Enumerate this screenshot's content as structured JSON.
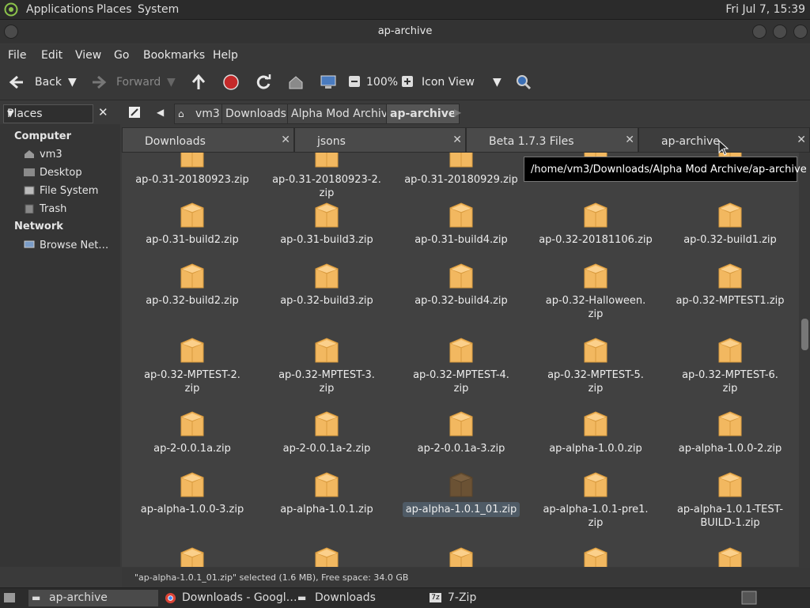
{
  "top_panel": {
    "menus": [
      "Applications",
      "Places",
      "System"
    ],
    "clock": "Fri Jul  7, 15:39"
  },
  "window": {
    "title": "ap-archive"
  },
  "menubar": [
    "File",
    "Edit",
    "View",
    "Go",
    "Bookmarks",
    "Help"
  ],
  "toolbar": {
    "back": "Back",
    "forward": "Forward",
    "zoom": "100%",
    "view_mode": "Icon View"
  },
  "sidebar": {
    "selector": "Places",
    "sections": [
      {
        "title": "Computer",
        "items": [
          "vm3",
          "Desktop",
          "File System",
          "Trash"
        ]
      },
      {
        "title": "Network",
        "items": [
          "Browse Net…"
        ]
      }
    ]
  },
  "breadcrumbs": [
    "vm3",
    "Downloads",
    "Alpha Mod Archive",
    "ap-archive"
  ],
  "tabs": [
    "Downloads",
    "jsons",
    "Beta 1.7.3 Files",
    "ap-archive"
  ],
  "tooltip": "/home/vm3/Downloads/Alpha Mod Archive/ap-archive",
  "files": [
    "ap-0.31-20180923.zip",
    "ap-0.31-20180923-2.zip",
    "ap-0.31-20180929.zip",
    "",
    "",
    "ap-0.31-build2.zip",
    "ap-0.31-build3.zip",
    "ap-0.31-build4.zip",
    "ap-0.32-20181106.zip",
    "ap-0.32-build1.zip",
    "ap-0.32-build2.zip",
    "ap-0.32-build3.zip",
    "ap-0.32-build4.zip",
    "ap-0.32-Halloween.zip",
    "ap-0.32-MPTEST1.zip",
    "ap-0.32-MPTEST-2.zip",
    "ap-0.32-MPTEST-3.zip",
    "ap-0.32-MPTEST-4.zip",
    "ap-0.32-MPTEST-5.zip",
    "ap-0.32-MPTEST-6.zip",
    "ap-2-0.0.1a.zip",
    "ap-2-0.0.1a-2.zip",
    "ap-2-0.0.1a-3.zip",
    "ap-alpha-1.0.0.zip",
    "ap-alpha-1.0.0-2.zip",
    "ap-alpha-1.0.0-3.zip",
    "ap-alpha-1.0.1.zip",
    "ap-alpha-1.0.1_01.zip",
    "ap-alpha-1.0.1-pre1.zip",
    "ap-alpha-1.0.1-TEST-BUILD-1.zip",
    "",
    "",
    "",
    "",
    ""
  ],
  "files_display": [
    [
      "ap-0.31-20180923.zip"
    ],
    [
      "ap-0.31-20180923-2.",
      "zip"
    ],
    [
      "ap-0.31-20180929.zip"
    ],
    [],
    [],
    [
      "ap-0.31-build2.zip"
    ],
    [
      "ap-0.31-build3.zip"
    ],
    [
      "ap-0.31-build4.zip"
    ],
    [
      "ap-0.32-20181106.zip"
    ],
    [
      "ap-0.32-build1.zip"
    ],
    [
      "ap-0.32-build2.zip"
    ],
    [
      "ap-0.32-build3.zip"
    ],
    [
      "ap-0.32-build4.zip"
    ],
    [
      "ap-0.32-Halloween.",
      "zip"
    ],
    [
      "ap-0.32-MPTEST1.zip"
    ],
    [
      "ap-0.32-MPTEST-2.",
      "zip"
    ],
    [
      "ap-0.32-MPTEST-3.",
      "zip"
    ],
    [
      "ap-0.32-MPTEST-4.",
      "zip"
    ],
    [
      "ap-0.32-MPTEST-5.",
      "zip"
    ],
    [
      "ap-0.32-MPTEST-6.",
      "zip"
    ],
    [
      "ap-2-0.0.1a.zip"
    ],
    [
      "ap-2-0.0.1a-2.zip"
    ],
    [
      "ap-2-0.0.1a-3.zip"
    ],
    [
      "ap-alpha-1.0.0.zip"
    ],
    [
      "ap-alpha-1.0.0-2.zip"
    ],
    [
      "ap-alpha-1.0.0-3.zip"
    ],
    [
      "ap-alpha-1.0.1.zip"
    ],
    [
      "ap-alpha-1.0.1_01.zip"
    ],
    [
      "ap-alpha-1.0.1-pre1.",
      "zip"
    ],
    [
      "ap-alpha-1.0.1-TEST-",
      "BUILD-1.zip"
    ],
    [],
    [],
    [],
    [],
    []
  ],
  "selected_file": "ap-alpha-1.0.1_01.zip",
  "status": "\"ap-alpha-1.0.1_01.zip\" selected (1.6 MB), Free space: 34.0 GB",
  "taskbar": [
    "ap-archive",
    "Downloads - Googl…",
    "Downloads",
    "7-Zip"
  ],
  "colors": {
    "folder": "#f2b860",
    "selected_folder": "#6b5234",
    "selection": "#4f5b66"
  }
}
